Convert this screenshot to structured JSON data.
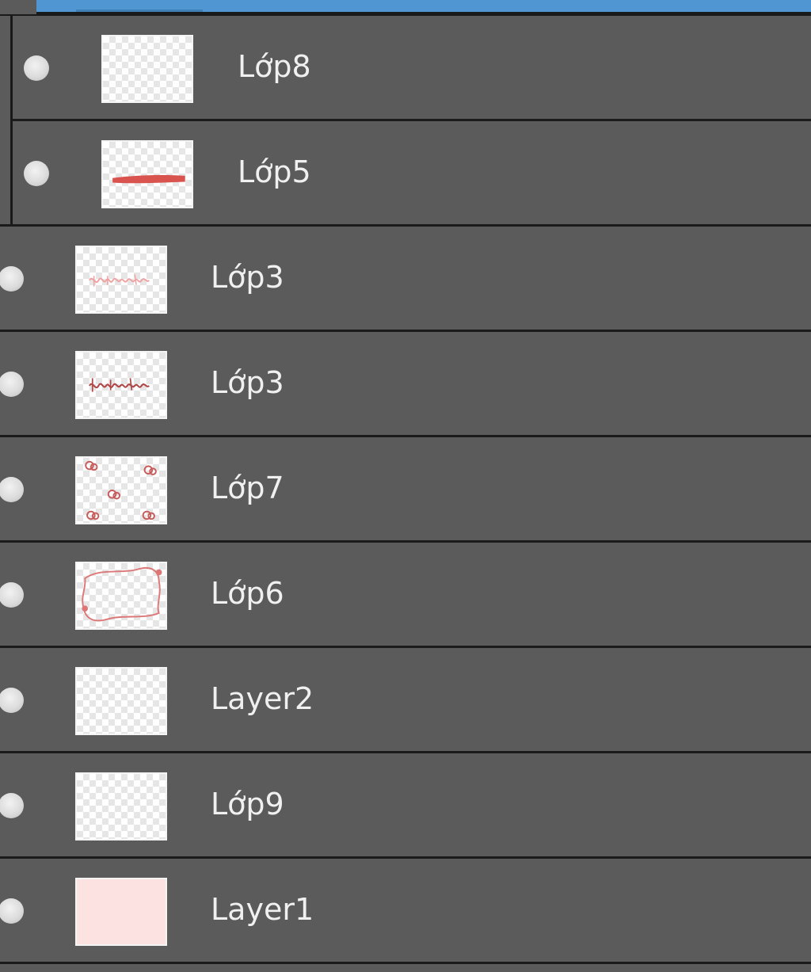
{
  "layers_panel": {
    "layers": [
      {
        "name": "Lớp8",
        "thumbnail": "empty"
      },
      {
        "name": "Lớp5",
        "thumbnail": "red-stroke"
      },
      {
        "name": "Lớp3",
        "thumbnail": "light-handwriting"
      },
      {
        "name": "Lớp3",
        "thumbnail": "handwriting"
      },
      {
        "name": "Lớp7",
        "thumbnail": "flower-doodles"
      },
      {
        "name": "Lớp6",
        "thumbnail": "frame-doodle"
      },
      {
        "name": "Layer2",
        "thumbnail": "empty"
      },
      {
        "name": "Lớp9",
        "thumbnail": "empty"
      },
      {
        "name": "Layer1",
        "thumbnail": "solid-pink"
      }
    ]
  },
  "colors": {
    "panel_bg": "#5b5b5b",
    "separator": "#1b1b1b",
    "selection": "#4f96d2",
    "stroke_red": "#d9534f",
    "fill_pink": "#fde2e2"
  },
  "icons": {
    "visibility": "visibility-dot-icon"
  }
}
